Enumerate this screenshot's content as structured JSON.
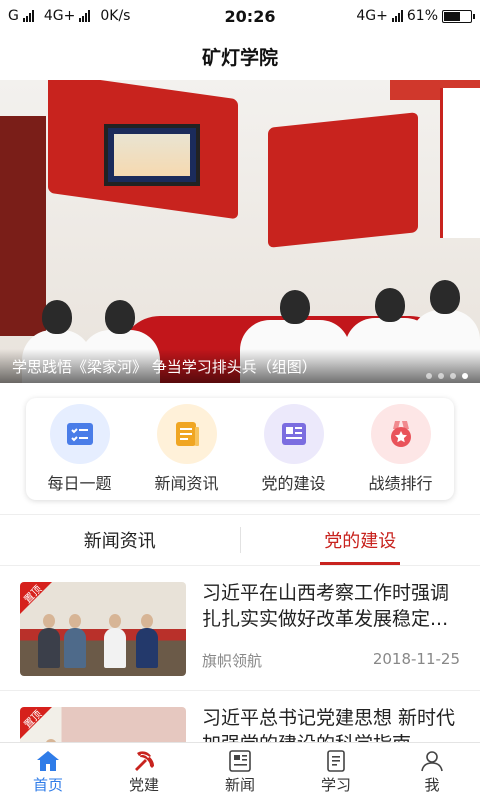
{
  "status_bar": {
    "carrier1": "G",
    "carrier2": "4G+",
    "speed": "0K/s",
    "time": "20:26",
    "carrier3": "4G+",
    "battery_text": "61%",
    "battery_level": 0.61
  },
  "app": {
    "title": "矿灯学院"
  },
  "banner": {
    "caption": "学思践悟《梁家河》 争当学习排头兵（组图）",
    "slide_count": 4,
    "active_slide": 4
  },
  "quick_links": [
    {
      "label": "每日一题",
      "icon": "checklist-icon",
      "color": "#4a7de8",
      "bg": "#e6eeff"
    },
    {
      "label": "新闻资讯",
      "icon": "news-doc-icon",
      "color": "#f0a623",
      "bg": "#fff1d9"
    },
    {
      "label": "党的建设",
      "icon": "newspaper-icon",
      "color": "#7b6de0",
      "bg": "#ece9fb"
    },
    {
      "label": "战绩排行",
      "icon": "medal-icon",
      "color": "#e9535a",
      "bg": "#fde6e6"
    }
  ],
  "tabs": [
    {
      "label": "新闻资讯",
      "active": false
    },
    {
      "label": "党的建设",
      "active": true
    }
  ],
  "news": [
    {
      "badge": "置顶",
      "title": "习近平在山西考察工作时强调 扎扎实实做好改革发展稳定...",
      "source": "旗帜领航",
      "date": "2018-11-25"
    },
    {
      "badge": "置顶",
      "title": "习近平总书记党建思想 新时代加强党的建设的科学指南",
      "source": "",
      "date": ""
    }
  ],
  "bottom_nav": [
    {
      "label": "首页",
      "icon": "home-icon",
      "active": true
    },
    {
      "label": "党建",
      "icon": "party-emblem-icon",
      "active": false
    },
    {
      "label": "新闻",
      "icon": "news-icon",
      "active": false
    },
    {
      "label": "学习",
      "icon": "book-icon",
      "active": false
    },
    {
      "label": "我",
      "icon": "user-icon",
      "active": false
    }
  ],
  "colors": {
    "accent_red": "#c8231e",
    "nav_active": "#2f7ce8"
  }
}
